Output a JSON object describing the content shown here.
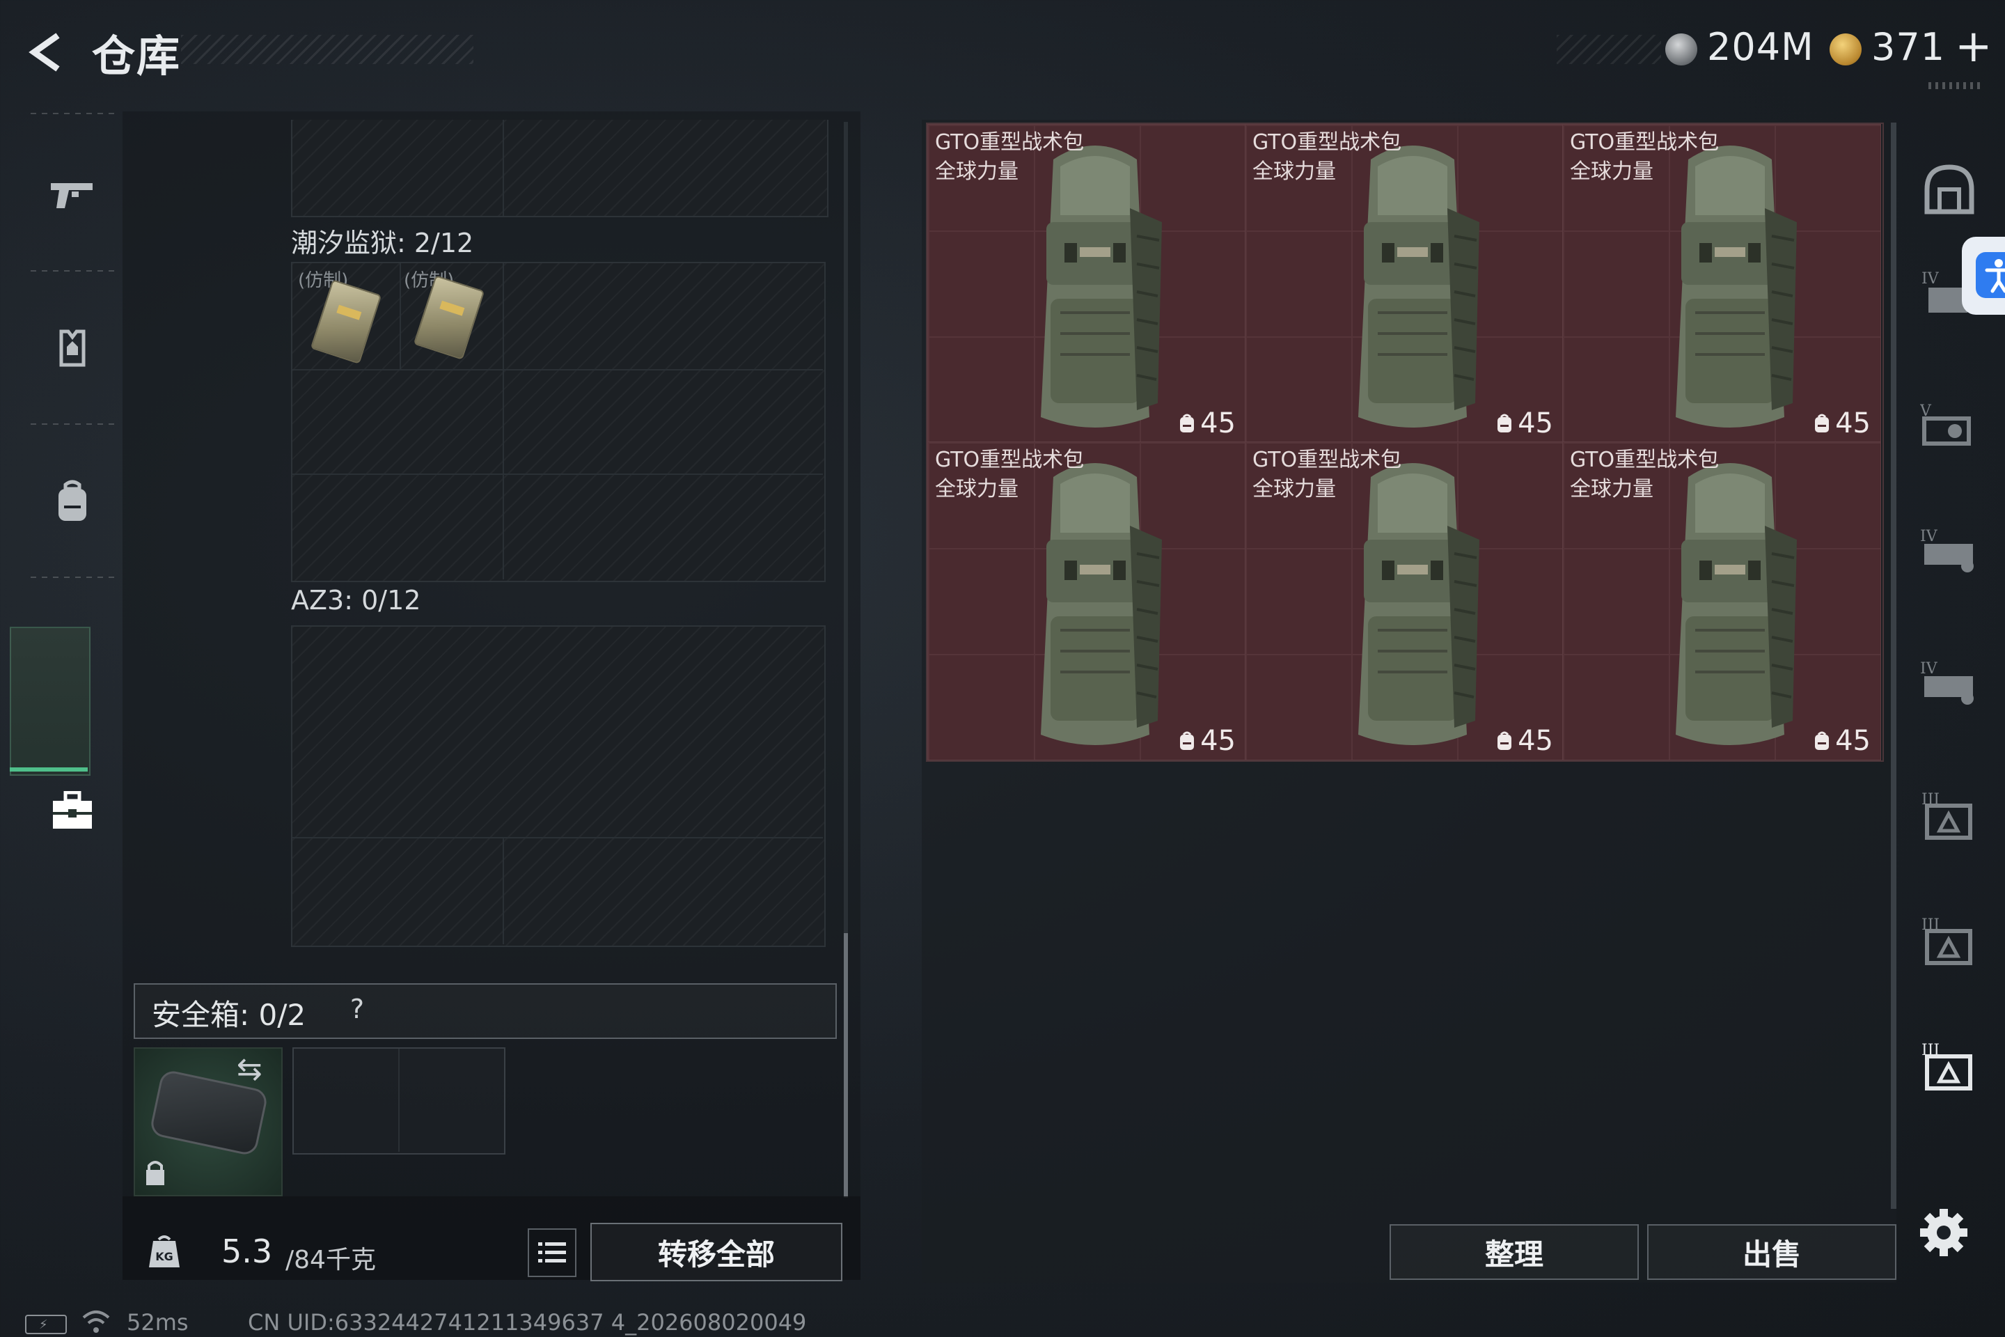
{
  "header": {
    "title": "仓库",
    "currency_silver": "204M",
    "currency_gold": "371",
    "plus_label": "+"
  },
  "left_nav": {
    "items": [
      {
        "icon": "pistol-icon"
      },
      {
        "icon": "armor-vest-icon"
      },
      {
        "icon": "backpack-icon"
      },
      {
        "icon": "chest-rig-icon"
      },
      {
        "icon": "toolbox-icon",
        "active": true
      }
    ]
  },
  "storage": {
    "section1_label": "潮汐监狱: 2/12",
    "fake_tag": "(仿制)",
    "section2_label": "AZ3: 0/12",
    "safe_box_label": "安全箱: 0/2",
    "safe_help": "?",
    "weight_value": "5.3",
    "weight_cap": "/84千克",
    "transfer_all": "转移全部"
  },
  "items": [
    {
      "name": "GTO重型战术包",
      "sub": "全球力量",
      "level": "45"
    },
    {
      "name": "GTO重型战术包",
      "sub": "全球力量",
      "level": "45"
    },
    {
      "name": "GTO重型战术包",
      "sub": "全球力量",
      "level": "45"
    },
    {
      "name": "GTO重型战术包",
      "sub": "全球力量",
      "level": "45"
    },
    {
      "name": "GTO重型战术包",
      "sub": "全球力量",
      "level": "45"
    },
    {
      "name": "GTO重型战术包",
      "sub": "全球力量",
      "level": "45"
    }
  ],
  "actions": {
    "sort": "整理",
    "sell": "出售"
  },
  "status": {
    "ping": "52ms",
    "uid": "CN UID:6332442741211349637 4_202608020049"
  },
  "colors": {
    "accent_green": "#4fbf8a",
    "item_bg": "#4a2a2f",
    "access_blue": "#2f7cf0"
  }
}
